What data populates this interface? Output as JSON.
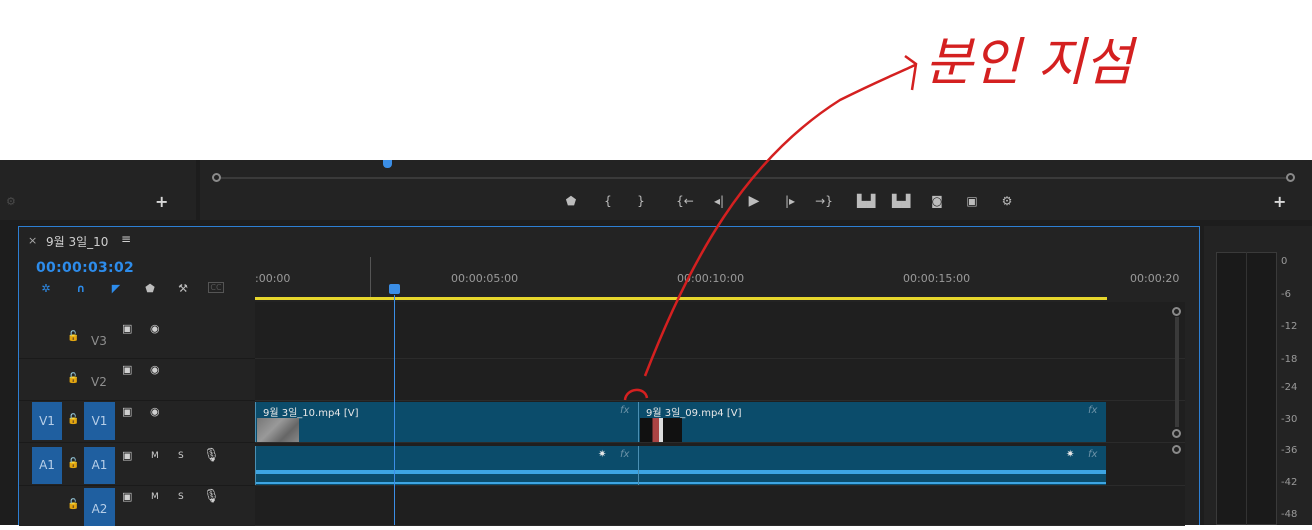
{
  "annotation": {
    "handwritten_text": "분인 지섬",
    "color": "#d42020"
  },
  "source_panel": {
    "icon": "wrench-dim-icon",
    "add_label": "+"
  },
  "program_monitor": {
    "add_label": "+",
    "playback_position_fraction": 0.16,
    "controls": [
      {
        "name": "marker-icon",
        "glyph": "⬟"
      },
      {
        "name": "mark-in-icon",
        "glyph": "{"
      },
      {
        "name": "mark-out-icon",
        "glyph": "}"
      },
      {
        "name": "go-to-in-icon",
        "glyph": "{←"
      },
      {
        "name": "step-back-icon",
        "glyph": "◂|"
      },
      {
        "name": "play-icon",
        "glyph": "▶"
      },
      {
        "name": "step-forward-icon",
        "glyph": "|▸"
      },
      {
        "name": "go-to-out-icon",
        "glyph": "→}"
      },
      {
        "name": "lift-icon",
        "glyph": "⏏"
      },
      {
        "name": "extract-icon",
        "glyph": "⏏"
      },
      {
        "name": "export-frame-icon",
        "glyph": "📷"
      },
      {
        "name": "compare-icon",
        "glyph": "▣"
      },
      {
        "name": "settings-icon",
        "glyph": "⚙"
      }
    ]
  },
  "timeline": {
    "tab_close": "×",
    "sequence_name": "9월 3일_10",
    "menu": "≡",
    "timecode": "00:00:03:02",
    "ruler_labels": [
      ":00:00",
      "00:00:05:00",
      "00:00:10:00",
      "00:00:15:00",
      "00:00:20"
    ],
    "tools": [
      {
        "name": "snap-icon",
        "glyph": "✲"
      },
      {
        "name": "linked-selection-icon",
        "glyph": "∩"
      },
      {
        "name": "nested-icon",
        "glyph": "◤"
      },
      {
        "name": "add-marker-icon",
        "glyph": "⬟"
      },
      {
        "name": "wrench-icon",
        "glyph": "🔧"
      },
      {
        "name": "captions-icon",
        "glyph": "CC"
      }
    ],
    "tracks": [
      {
        "id": "v3",
        "name": "V3",
        "source": "",
        "lock": "🔓",
        "type": "video"
      },
      {
        "id": "v2",
        "name": "V2",
        "source": "",
        "lock": "🔓",
        "type": "video"
      },
      {
        "id": "v1",
        "name": "V1",
        "source": "V1",
        "lock": "🔓",
        "type": "video"
      },
      {
        "id": "a1",
        "name": "A1",
        "source": "A1",
        "lock": "🔓",
        "type": "audio"
      },
      {
        "id": "a2",
        "name": "A2",
        "source": "",
        "lock": "🔓",
        "type": "audio"
      }
    ],
    "track_icons": {
      "film": "⎚",
      "eye": "◉",
      "mute": "M",
      "solo": "S",
      "mic": "🎙"
    },
    "clips": {
      "video1": "9월 3일_10.mp4 [V]",
      "video2": "9월 3일_09.mp4 [V]",
      "fx": "fx",
      "audio_marker": "✷"
    }
  },
  "meters": {
    "labels": [
      "0",
      "-6",
      "-12",
      "-18",
      "-24",
      "-30",
      "-36",
      "-42",
      "-48"
    ]
  }
}
